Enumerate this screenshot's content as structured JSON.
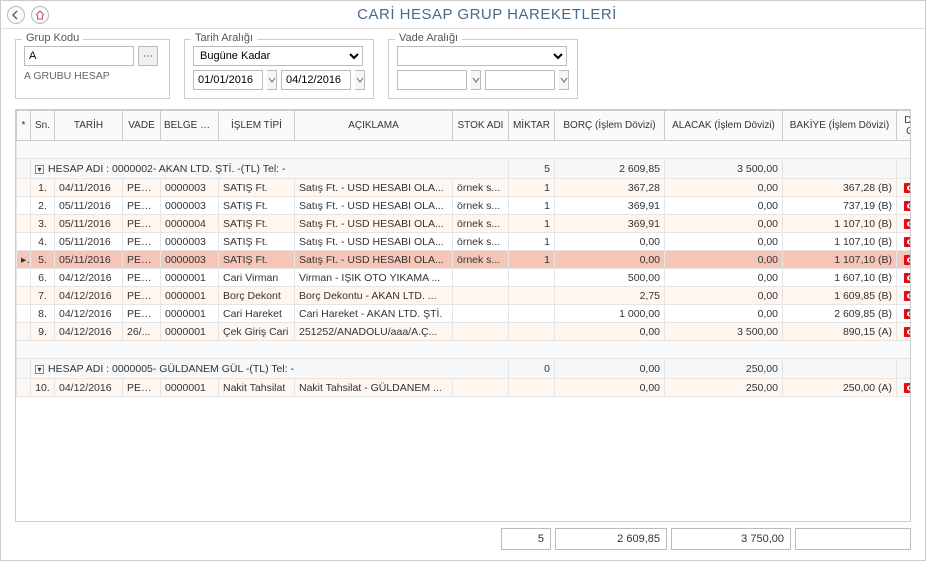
{
  "title": "CARİ HESAP GRUP HAREKETLERİ",
  "filters": {
    "grup_kodu": {
      "legend": "Grup Kodu",
      "value": "A",
      "desc": "A GRUBU HESAP"
    },
    "tarih": {
      "legend": "Tarih Aralığı",
      "mode": "Bugüne Kadar",
      "from": "01/01/2016",
      "to": "04/12/2016"
    },
    "vade": {
      "legend": "Vade Aralığı",
      "mode": "",
      "from": "",
      "to": ""
    }
  },
  "columns": {
    "marker": "*",
    "sn": "Sn.",
    "tarih": "TARİH",
    "vade": "VADE",
    "belge": "BELGE NO",
    "tip": "İŞLEM TİPİ",
    "aciklama": "AÇIKLAMA",
    "stok": "STOK ADI",
    "miktar": "MİKTAR",
    "borc": "BORÇ (İşlem Dövizi)",
    "alacak": "ALACAK (İşlem Dövizi)",
    "bakiye": "BAKİYE (İşlem Dövizi)",
    "doviz": "DÖVİZ CİNSİ"
  },
  "groups": [
    {
      "header": "HESAP ADI : 0000002- AKAN LTD. ŞTİ. -(TL) Tel: -",
      "miktar": "5",
      "borc": "2 609,85",
      "alacak": "3 500,00",
      "rows": [
        {
          "sn": "1.",
          "tarih": "04/11/2016",
          "vade": "PEŞİN",
          "belge": "0000003",
          "tip": "SATIŞ Ft.",
          "acik": "Satış Ft. - USD HESABI OLA...",
          "stok": "örnek s...",
          "miktar": "1",
          "borc": "367,28",
          "alacak": "0,00",
          "bakiye": "367,28 (B)",
          "doviz": "TL",
          "alt": true,
          "sel": false
        },
        {
          "sn": "2.",
          "tarih": "05/11/2016",
          "vade": "PEŞİN",
          "belge": "0000003",
          "tip": "SATIŞ Ft.",
          "acik": "Satış Ft. - USD HESABI OLA...",
          "stok": "örnek s...",
          "miktar": "1",
          "borc": "369,91",
          "alacak": "0,00",
          "bakiye": "737,19 (B)",
          "doviz": "TL",
          "alt": false,
          "sel": false
        },
        {
          "sn": "3.",
          "tarih": "05/11/2016",
          "vade": "PEŞİN",
          "belge": "0000004",
          "tip": "SATIŞ Ft.",
          "acik": "Satış Ft. - USD HESABI OLA...",
          "stok": "örnek s...",
          "miktar": "1",
          "borc": "369,91",
          "alacak": "0,00",
          "bakiye": "1 107,10 (B)",
          "doviz": "TL",
          "alt": true,
          "sel": false
        },
        {
          "sn": "4.",
          "tarih": "05/11/2016",
          "vade": "PEŞİN",
          "belge": "0000003",
          "tip": "SATIŞ Ft.",
          "acik": "Satış Ft. - USD HESABI OLA...",
          "stok": "örnek s...",
          "miktar": "1",
          "borc": "0,00",
          "alacak": "0,00",
          "bakiye": "1 107,10 (B)",
          "doviz": "TL",
          "alt": false,
          "sel": false
        },
        {
          "sn": "5.",
          "tarih": "05/11/2016",
          "vade": "PEŞİN",
          "belge": "0000003",
          "tip": "SATIŞ Ft.",
          "acik": "Satış Ft. - USD HESABI OLA...",
          "stok": "örnek s...",
          "miktar": "1",
          "borc": "0,00",
          "alacak": "0,00",
          "bakiye": "1 107,10 (B)",
          "doviz": "TL",
          "alt": false,
          "sel": true
        },
        {
          "sn": "6.",
          "tarih": "04/12/2016",
          "vade": "PEŞİN",
          "belge": "0000001",
          "tip": "Cari Virman",
          "acik": "Virman - IŞIK OTO YIKAMA ...",
          "stok": "",
          "miktar": "",
          "borc": "500,00",
          "alacak": "0,00",
          "bakiye": "1 607,10 (B)",
          "doviz": "TL",
          "alt": false,
          "sel": false
        },
        {
          "sn": "7.",
          "tarih": "04/12/2016",
          "vade": "PEŞİN",
          "belge": "0000001",
          "tip": "Borç Dekont",
          "acik": "Borç Dekontu - AKAN LTD. ...",
          "stok": "",
          "miktar": "",
          "borc": "2,75",
          "alacak": "0,00",
          "bakiye": "1 609,85 (B)",
          "doviz": "TL",
          "alt": true,
          "sel": false
        },
        {
          "sn": "8.",
          "tarih": "04/12/2016",
          "vade": "PEŞİN",
          "belge": "0000001",
          "tip": "Cari Hareket",
          "acik": "Cari Hareket - AKAN LTD. ŞTİ.",
          "stok": "",
          "miktar": "",
          "borc": "1 000,00",
          "alacak": "0,00",
          "bakiye": "2 609,85 (B)",
          "doviz": "TL",
          "alt": false,
          "sel": false
        },
        {
          "sn": "9.",
          "tarih": "04/12/2016",
          "vade": "26/...",
          "belge": "0000001",
          "tip": "Çek Giriş Cari",
          "acik": "251252/ANADOLU/aaa/A.Ç...",
          "stok": "",
          "miktar": "",
          "borc": "0,00",
          "alacak": "3 500,00",
          "bakiye": "890,15 (A)",
          "doviz": "TL",
          "alt": true,
          "sel": false
        }
      ]
    },
    {
      "header": "HESAP ADI : 0000005- GÜLDANEM GÜL -(TL) Tel: -",
      "miktar": "0",
      "borc": "0,00",
      "alacak": "250,00",
      "rows": [
        {
          "sn": "10.",
          "tarih": "04/12/2016",
          "vade": "PEŞİN",
          "belge": "0000001",
          "tip": "Nakit Tahsilat",
          "acik": "Nakit Tahsilat - GÜLDANEM ...",
          "stok": "",
          "miktar": "",
          "borc": "0,00",
          "alacak": "250,00",
          "bakiye": "250,00 (A)",
          "doviz": "TL",
          "alt": true,
          "sel": false
        }
      ]
    }
  ],
  "totals": {
    "miktar": "5",
    "borc": "2 609,85",
    "alacak": "3 750,00",
    "bakiye": ""
  }
}
